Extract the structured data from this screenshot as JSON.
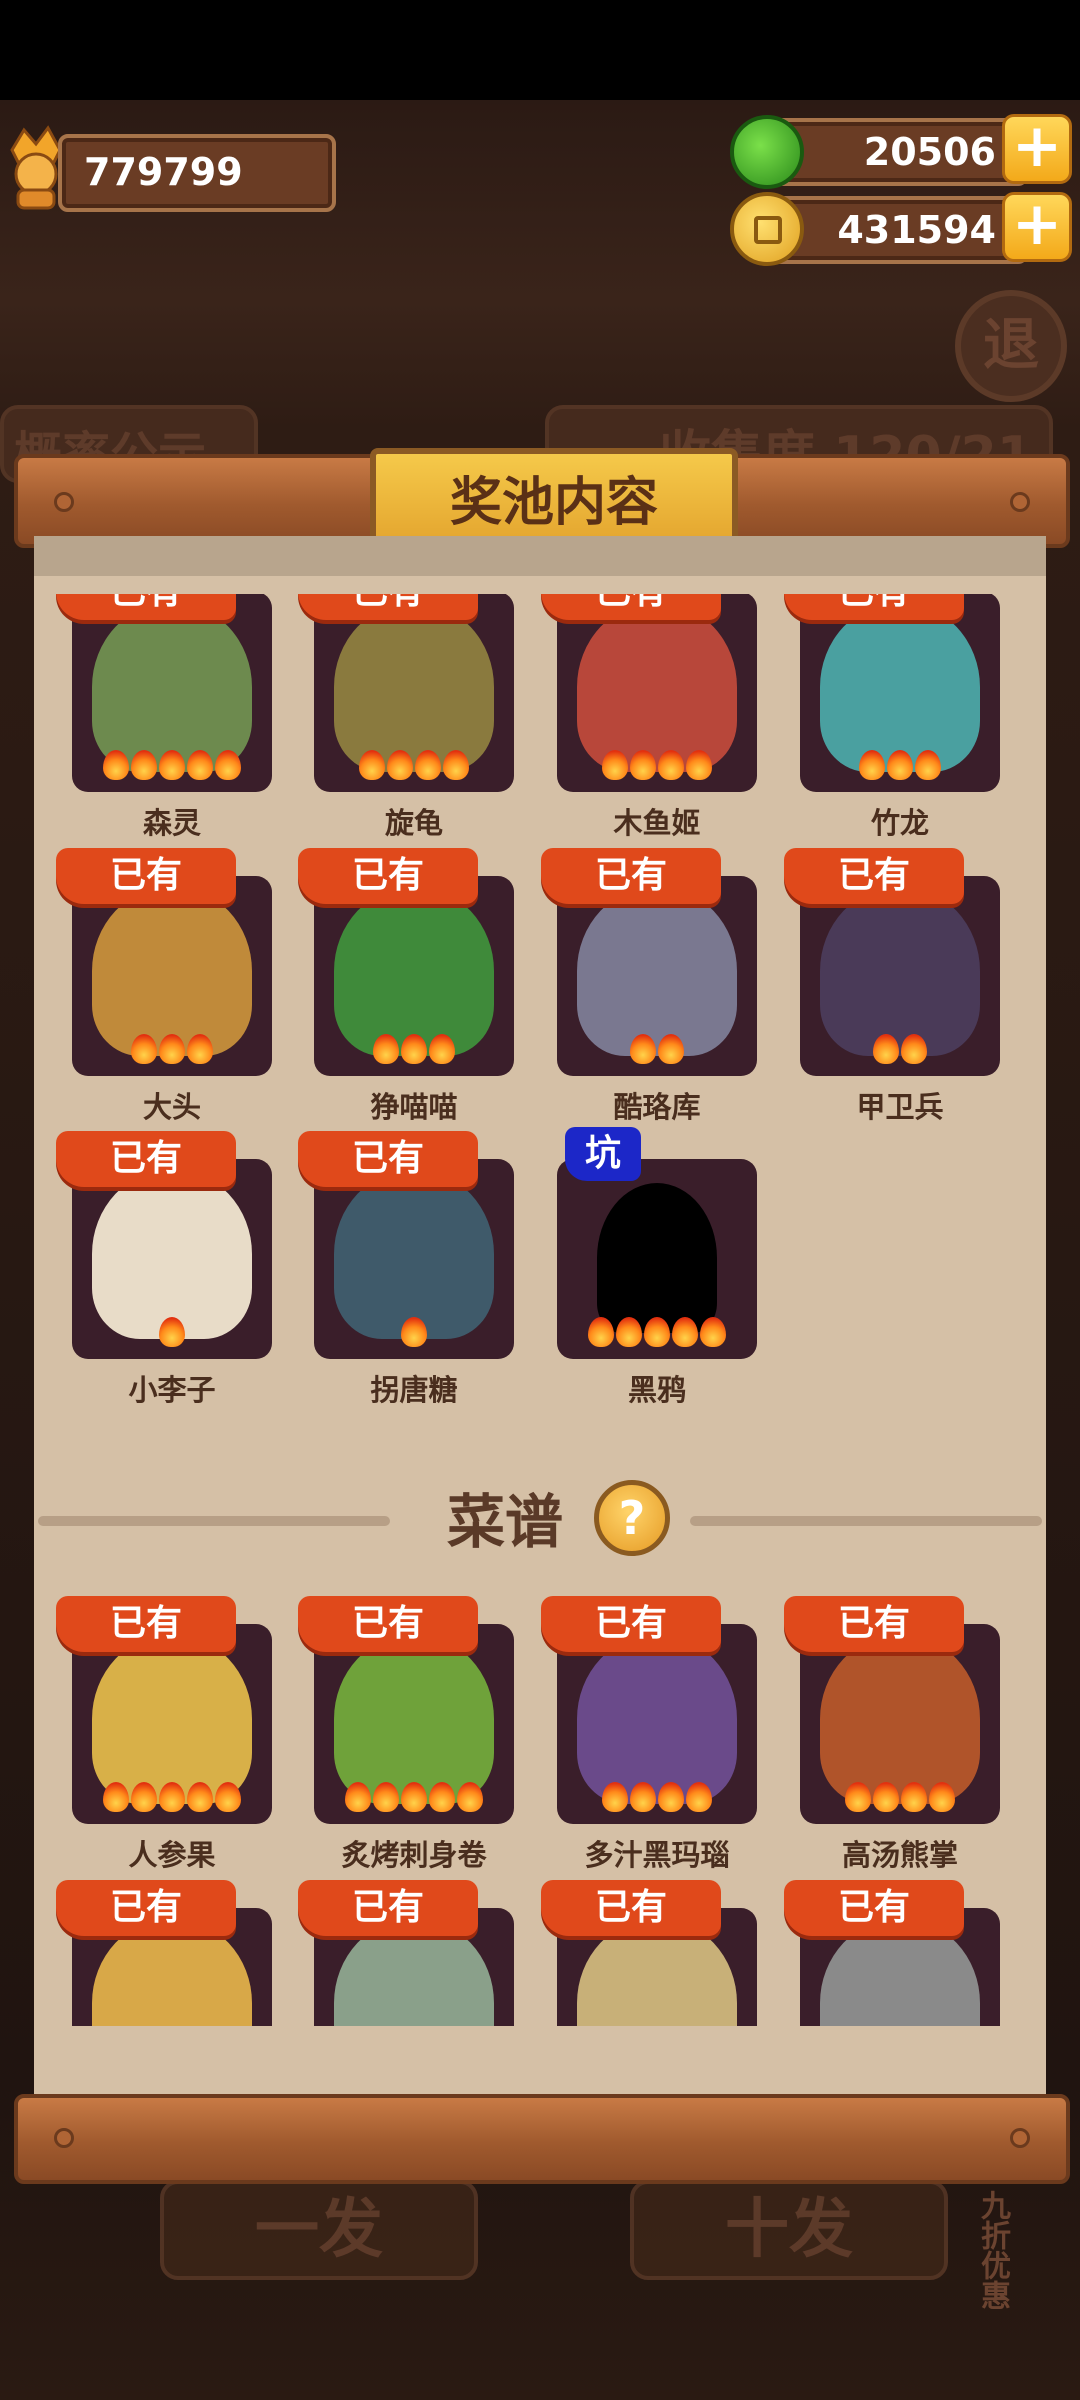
{
  "topbar": {
    "player_score": "779799",
    "gems": "20506",
    "coins": "431594",
    "plus_label": "+"
  },
  "background": {
    "exit_label": "退",
    "panel_left_text": "概率公示",
    "panel_right_text": "收集度 120/21",
    "btn_one": "一发",
    "btn_ten": "十发",
    "discount_label": "九折优惠"
  },
  "dialog": {
    "title": "奖池内容",
    "recipes_header": "菜谱",
    "help_label": "?"
  },
  "characters": [
    {
      "name": "森灵",
      "tag": "已有",
      "flames": 5,
      "color": "#6d8a4e"
    },
    {
      "name": "旋龟",
      "tag": "已有",
      "flames": 4,
      "color": "#8a7a3e"
    },
    {
      "name": "木鱼姬",
      "tag": "已有",
      "flames": 4,
      "color": "#b8473a"
    },
    {
      "name": "竹龙",
      "tag": "已有",
      "flames": 3,
      "color": "#4aa0a0"
    },
    {
      "name": "大头",
      "tag": "已有",
      "flames": 3,
      "color": "#c08a3a"
    },
    {
      "name": "狰喵喵",
      "tag": "已有",
      "flames": 3,
      "color": "#3f8a3a"
    },
    {
      "name": "酷珞库",
      "tag": "已有",
      "flames": 2,
      "color": "#7a7890"
    },
    {
      "name": "甲卫兵",
      "tag": "已有",
      "flames": 2,
      "color": "#4a3a58"
    },
    {
      "name": "小李子",
      "tag": "已有",
      "flames": 1,
      "color": "#e8dcc8"
    },
    {
      "name": "拐唐糖",
      "tag": "已有",
      "flames": 1,
      "color": "#3f5a6a"
    },
    {
      "name": "黑鸦",
      "tag": "坑",
      "flames": 5,
      "color": "#000000"
    }
  ],
  "recipes": [
    {
      "name": "人参果",
      "tag": "已有",
      "flames": 5,
      "color": "#d8b048"
    },
    {
      "name": "炙烤刺身卷",
      "tag": "已有",
      "flames": 5,
      "color": "#6fa23a"
    },
    {
      "name": "多汁黑玛瑙",
      "tag": "已有",
      "flames": 4,
      "color": "#6a4a8a"
    },
    {
      "name": "高汤熊掌",
      "tag": "已有",
      "flames": 4,
      "color": "#b0542a"
    },
    {
      "name": "",
      "tag": "已有",
      "flames": 0,
      "color": "#d8a848"
    },
    {
      "name": "",
      "tag": "已有",
      "flames": 0,
      "color": "#8aa08a"
    },
    {
      "name": "",
      "tag": "已有",
      "flames": 0,
      "color": "#c8b078"
    },
    {
      "name": "",
      "tag": "已有",
      "flames": 0,
      "color": "#8a8a8a"
    }
  ]
}
